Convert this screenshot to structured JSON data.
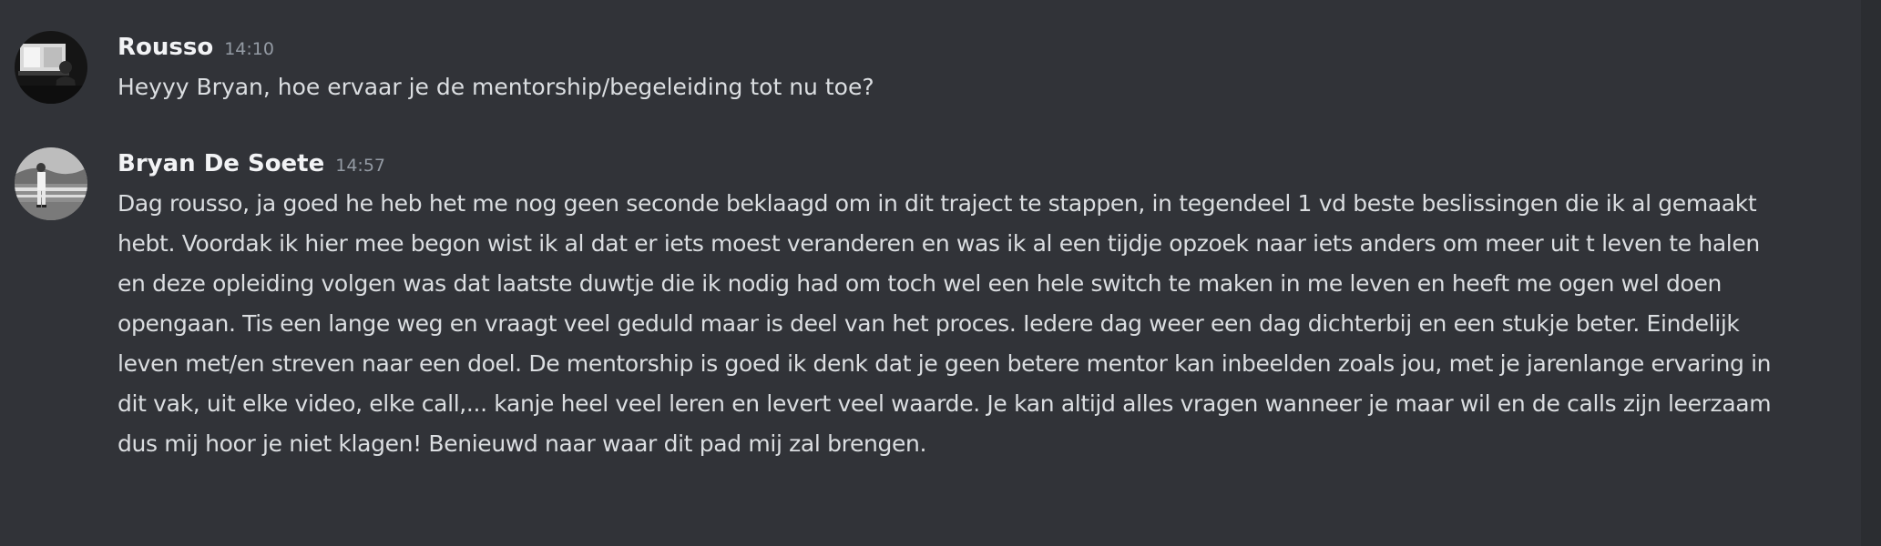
{
  "messages": [
    {
      "author": "Rousso",
      "timestamp": "14:10",
      "avatar_icon": "user-avatar-icon",
      "text": "Heyyy Bryan, hoe ervaar je de mentorship/begeleiding tot nu toe?"
    },
    {
      "author": "Bryan De Soete",
      "timestamp": "14:57",
      "avatar_icon": "user-avatar-icon",
      "text": "Dag rousso, ja goed he heb het me nog geen seconde beklaagd om in dit traject te stappen, in tegendeel 1 vd beste beslissingen die ik al gemaakt hebt. Voordak ik hier mee begon wist ik al dat er iets moest veranderen en was ik al een tijdje opzoek naar iets anders om meer uit t leven te halen en deze opleiding volgen was dat laatste duwtje die ik nodig had om toch wel een hele switch te maken in me leven en heeft me ogen wel doen opengaan. Tis een lange weg en vraagt veel geduld maar is deel van het proces. Iedere dag weer een dag dichterbij en een stukje beter. Eindelijk leven met/en streven naar een doel. De mentorship is goed ik denk dat je geen betere mentor kan inbeelden zoals jou, met je jarenlange ervaring in dit vak, uit elke video, elke call,... kanje heel veel leren en levert veel waarde. Je kan altijd alles vragen wanneer je maar wil en de calls zijn leerzaam dus mij hoor je niet klagen! Benieuwd naar waar dit pad mij zal brengen."
    }
  ],
  "colors": {
    "background": "#313338",
    "username": "#f2f3f5",
    "timestamp": "#949ba4",
    "message_text": "#dbdee1"
  }
}
